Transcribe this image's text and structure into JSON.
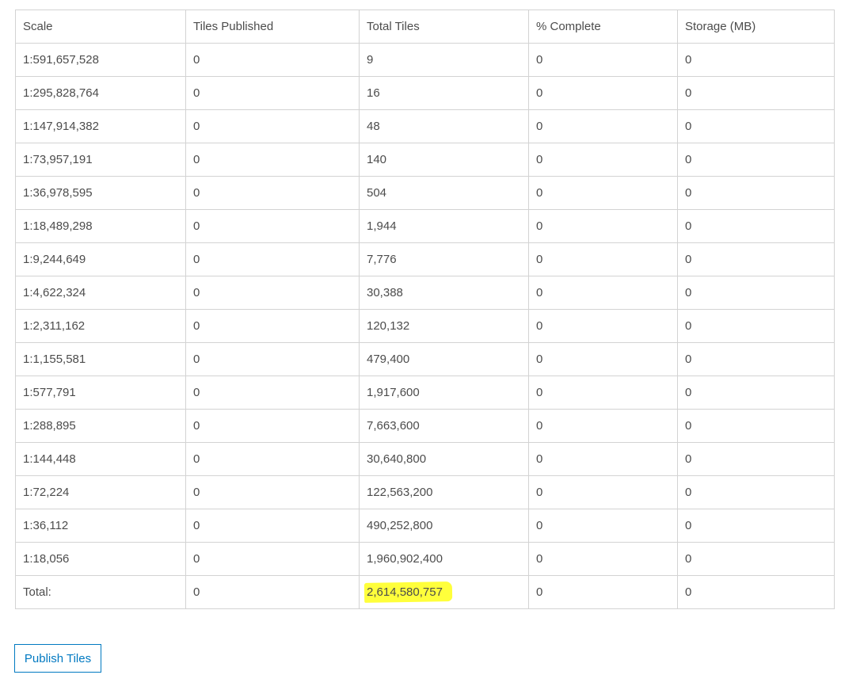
{
  "table": {
    "headers": [
      "Scale",
      "Tiles Published",
      "Total Tiles",
      "% Complete",
      "Storage (MB)"
    ],
    "rows": [
      [
        "1:591,657,528",
        "0",
        "9",
        "0",
        "0"
      ],
      [
        "1:295,828,764",
        "0",
        "16",
        "0",
        "0"
      ],
      [
        "1:147,914,382",
        "0",
        "48",
        "0",
        "0"
      ],
      [
        "1:73,957,191",
        "0",
        "140",
        "0",
        "0"
      ],
      [
        "1:36,978,595",
        "0",
        "504",
        "0",
        "0"
      ],
      [
        "1:18,489,298",
        "0",
        "1,944",
        "0",
        "0"
      ],
      [
        "1:9,244,649",
        "0",
        "7,776",
        "0",
        "0"
      ],
      [
        "1:4,622,324",
        "0",
        "30,388",
        "0",
        "0"
      ],
      [
        "1:2,311,162",
        "0",
        "120,132",
        "0",
        "0"
      ],
      [
        "1:1,155,581",
        "0",
        "479,400",
        "0",
        "0"
      ],
      [
        "1:577,791",
        "0",
        "1,917,600",
        "0",
        "0"
      ],
      [
        "1:288,895",
        "0",
        "7,663,600",
        "0",
        "0"
      ],
      [
        "1:144,448",
        "0",
        "30,640,800",
        "0",
        "0"
      ],
      [
        "1:72,224",
        "0",
        "122,563,200",
        "0",
        "0"
      ],
      [
        "1:36,112",
        "0",
        "490,252,800",
        "0",
        "0"
      ],
      [
        "1:18,056",
        "0",
        "1,960,902,400",
        "0",
        "0"
      ]
    ],
    "total_row": {
      "label": "Total:",
      "tiles_published": "0",
      "total_tiles": "2,614,580,757",
      "percent_complete": "0",
      "storage_mb": "0"
    }
  },
  "highlight_color": "#ffff3b",
  "accent_color": "#0079c1",
  "publish_button_label": "Publish Tiles"
}
